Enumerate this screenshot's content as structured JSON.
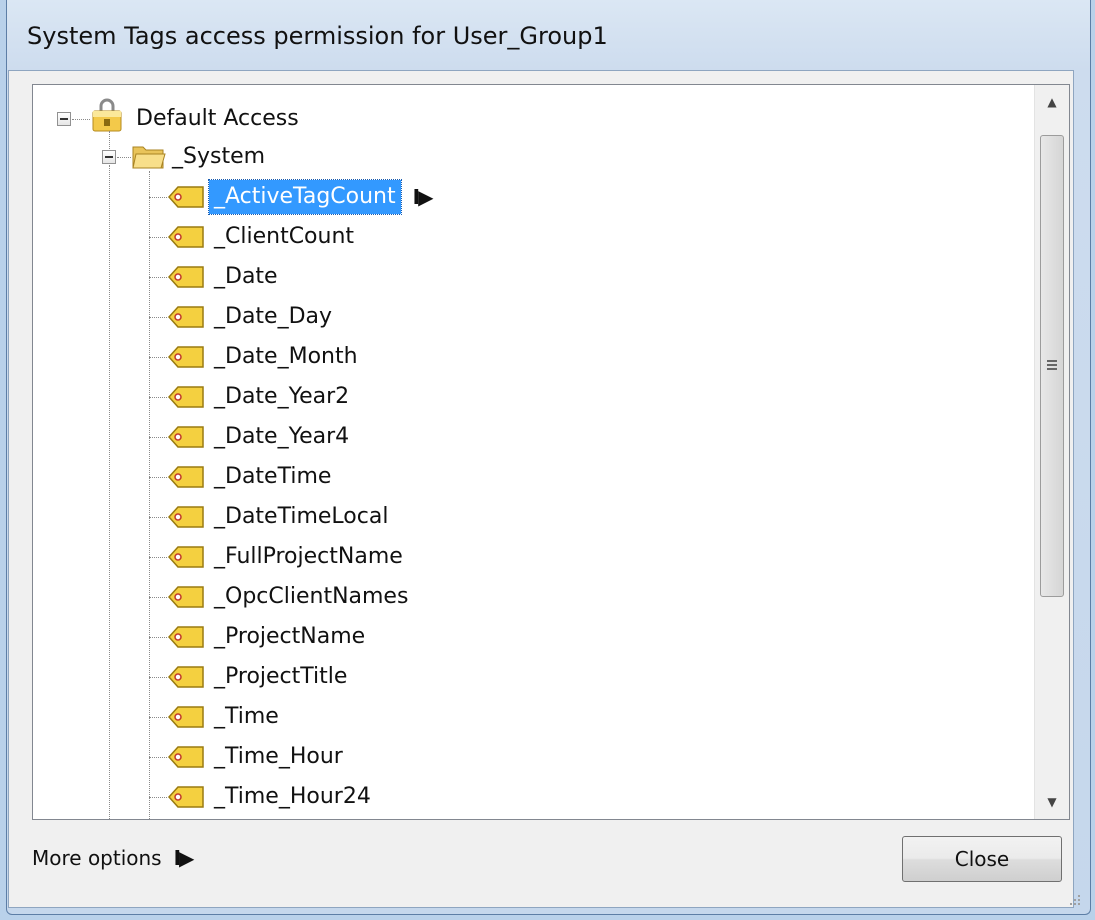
{
  "window": {
    "title": "System Tags access permission for User_Group1"
  },
  "tree": {
    "root": {
      "label": "Default Access",
      "icon": "lock-folder-icon"
    },
    "folder": {
      "label": "_System",
      "icon": "folder-icon"
    },
    "tags": [
      "_ActiveTagCount",
      "_ClientCount",
      "_Date",
      "_Date_Day",
      "_Date_Month",
      "_Date_Year2",
      "_Date_Year4",
      "_DateTime",
      "_DateTimeLocal",
      "_FullProjectName",
      "_OpcClientNames",
      "_ProjectName",
      "_ProjectTitle",
      "_Time",
      "_Time_Hour",
      "_Time_Hour24"
    ],
    "selected_index": 0,
    "selected_arrow": "I▶"
  },
  "footer": {
    "more_options": "More options",
    "more_options_arrow": "I▶",
    "close_label": "Close"
  },
  "colors": {
    "selection": "#3399ff",
    "tag_yellow": "#f4d040"
  }
}
